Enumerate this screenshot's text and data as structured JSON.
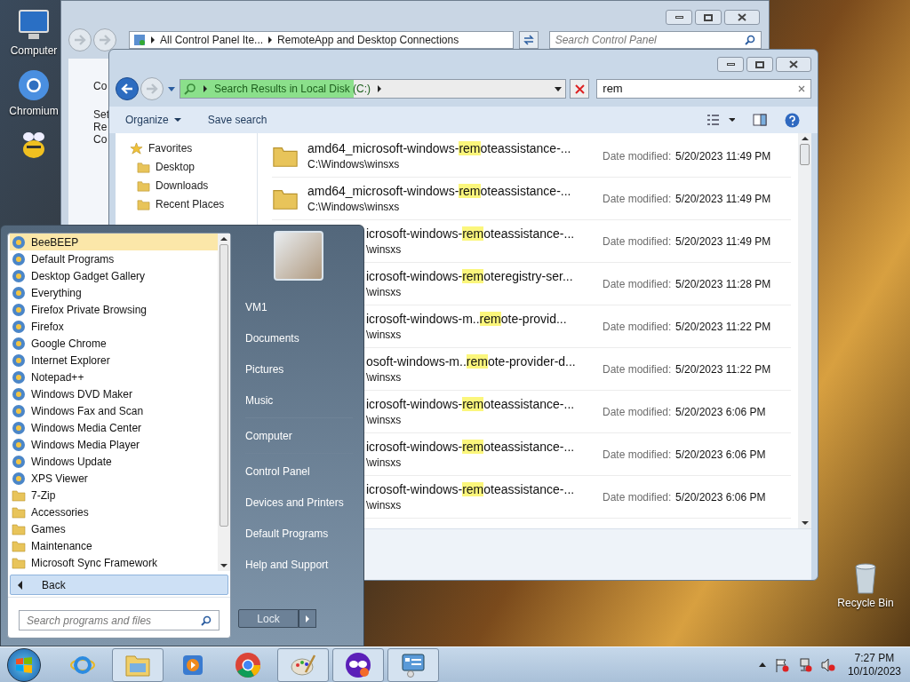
{
  "desktop_icons": [
    {
      "kind": "computer",
      "label": "Computer"
    },
    {
      "kind": "chromium",
      "label": "Chromium"
    },
    {
      "kind": "bee"
    },
    {
      "kind": "recycle",
      "label": "Recycle Bin"
    }
  ],
  "control_panel_window": {
    "breadcrumb": [
      "All Control Panel Ite...",
      "RemoteApp and Desktop Connections"
    ],
    "search_placeholder": "Search Control Panel",
    "left_texts": [
      "Co",
      "Set",
      "Re",
      "Co"
    ]
  },
  "explorer_window": {
    "address": "Search Results in Local Disk (C:)",
    "search_value": "rem",
    "toolbar": [
      "Organize",
      "Save search"
    ],
    "favorites": {
      "label": "Favorites",
      "items": [
        "Desktop",
        "Downloads",
        "Recent Places"
      ]
    },
    "results": [
      {
        "kind": "full",
        "pre": "amd64_microsoft-windows-",
        "match": "rem",
        "post": "oteassistance-...",
        "path": "C:\\Windows\\winsxs",
        "date_label": "Date modified:",
        "date": "5/20/2023 11:49 PM"
      },
      {
        "kind": "full",
        "pre": "amd64_microsoft-windows-",
        "match": "rem",
        "post": "oteassistance-...",
        "path": "C:\\Windows\\winsxs",
        "date_label": "Date modified:",
        "date": "5/20/2023 11:49 PM"
      },
      {
        "kind": "covered",
        "pre": "icrosoft-windows-",
        "match": "rem",
        "post": "oteassistance-...",
        "path": "\\winsxs",
        "date_label": "Date modified:",
        "date": "5/20/2023 11:49 PM"
      },
      {
        "kind": "covered",
        "pre": "icrosoft-windows-",
        "match": "rem",
        "post": "oteregistry-ser...",
        "path": "\\winsxs",
        "date_label": "Date modified:",
        "date": "5/20/2023 11:28 PM"
      },
      {
        "kind": "covered",
        "pre": "icrosoft-windows-m..",
        "match": "rem",
        "post": "ote-provid...",
        "path": "\\winsxs",
        "date_label": "Date modified:",
        "date": "5/20/2023 11:22 PM"
      },
      {
        "kind": "covered",
        "pre": "osoft-windows-m..",
        "match": "rem",
        "post": "ote-provider-d...",
        "path": "\\winsxs",
        "date_label": "Date modified:",
        "date": "5/20/2023 11:22 PM"
      },
      {
        "kind": "covered",
        "pre": "icrosoft-windows-",
        "match": "rem",
        "post": "oteassistance-...",
        "path": "\\winsxs",
        "date_label": "Date modified:",
        "date": "5/20/2023 6:06 PM"
      },
      {
        "kind": "covered",
        "pre": "icrosoft-windows-",
        "match": "rem",
        "post": "oteassistance-...",
        "path": "\\winsxs",
        "date_label": "Date modified:",
        "date": "5/20/2023 6:06 PM"
      },
      {
        "kind": "covered",
        "pre": "icrosoft-windows-",
        "match": "rem",
        "post": "oteassistance-...",
        "path": "\\winsxs",
        "date_label": "Date modified:",
        "date": "5/20/2023 6:06 PM"
      }
    ]
  },
  "start_menu": {
    "programs": [
      {
        "label": "BeeBEEP",
        "kind": "app",
        "selected": true
      },
      {
        "label": "Default Programs",
        "kind": "app",
        "selected": false
      },
      {
        "label": "Desktop Gadget Gallery",
        "kind": "app",
        "selected": false
      },
      {
        "label": "Everything",
        "kind": "app",
        "selected": false
      },
      {
        "label": "Firefox Private Browsing",
        "kind": "app",
        "selected": false
      },
      {
        "label": "Firefox",
        "kind": "app",
        "selected": false
      },
      {
        "label": "Google Chrome",
        "kind": "app",
        "selected": false
      },
      {
        "label": "Internet Explorer",
        "kind": "app",
        "selected": false
      },
      {
        "label": "Notepad++",
        "kind": "app",
        "selected": false
      },
      {
        "label": "Windows DVD Maker",
        "kind": "app",
        "selected": false
      },
      {
        "label": "Windows Fax and Scan",
        "kind": "app",
        "selected": false
      },
      {
        "label": "Windows Media Center",
        "kind": "app",
        "selected": false
      },
      {
        "label": "Windows Media Player",
        "kind": "app",
        "selected": false
      },
      {
        "label": "Windows Update",
        "kind": "app",
        "selected": false
      },
      {
        "label": "XPS Viewer",
        "kind": "app",
        "selected": false
      },
      {
        "label": "7-Zip",
        "kind": "folder",
        "selected": false
      },
      {
        "label": "Accessories",
        "kind": "folder",
        "selected": false
      },
      {
        "label": "Games",
        "kind": "folder",
        "selected": false
      },
      {
        "label": "Maintenance",
        "kind": "folder",
        "selected": false
      },
      {
        "label": "Microsoft Sync Framework",
        "kind": "folder",
        "selected": false
      }
    ],
    "back": "Back",
    "search_placeholder": "Search programs and files",
    "right_groups": [
      [
        "VM1",
        "Documents",
        "Pictures",
        "Music"
      ],
      [
        "Computer"
      ],
      [
        "Control Panel",
        "Devices and Printers",
        "Default Programs",
        "Help and Support"
      ]
    ],
    "lock": "Lock"
  },
  "taskbar": {
    "items": [
      {
        "kind": "ie",
        "running": false
      },
      {
        "kind": "explorer",
        "running": true
      },
      {
        "kind": "media",
        "running": false
      },
      {
        "kind": "chrome",
        "running": false
      },
      {
        "kind": "paint",
        "running": true
      },
      {
        "kind": "mask",
        "running": true
      },
      {
        "kind": "panel",
        "running": true
      }
    ],
    "time": "7:27 PM",
    "date": "10/10/2023"
  }
}
